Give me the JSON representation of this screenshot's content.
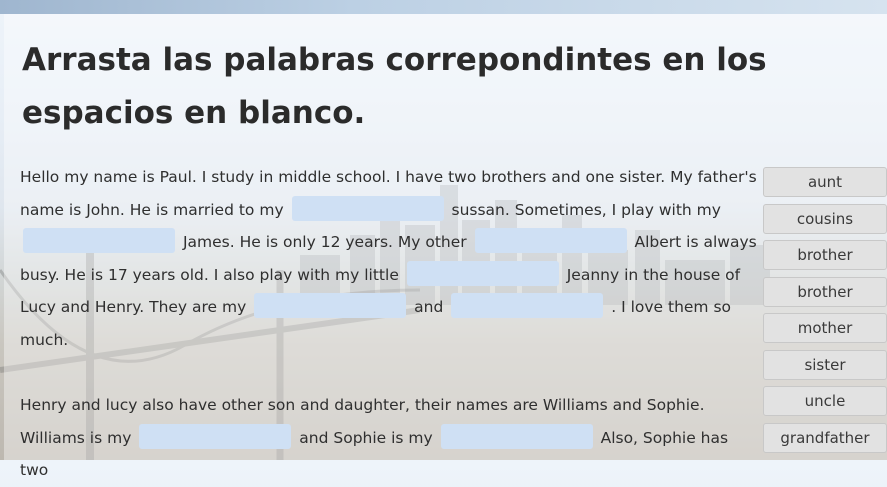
{
  "title": "Arrasta las palabras correpondintes en los espacios en blanco.",
  "paragraph1": [
    "Hello my name is Paul. I study in middle school. I have two brothers and one sister. My father's name is John. He is married to my",
    "sussan. Sometimes, I play with my",
    "James. He is only 12 years. My other",
    "Albert is always busy. He is 17 years old. I also play with my little",
    "Jeanny in the house of Lucy and Henry. They are my",
    "and",
    ". I love them so much."
  ],
  "paragraph2": [
    "Henry and lucy also have other son and daughter, their names are Williams and Sophie. Williams is my",
    "and Sophie is my",
    "Also, Sophie has two"
  ],
  "word_bank": [
    "aunt",
    "cousins",
    "brother",
    "brother",
    "mother",
    "sister",
    "uncle",
    "grandfather"
  ]
}
